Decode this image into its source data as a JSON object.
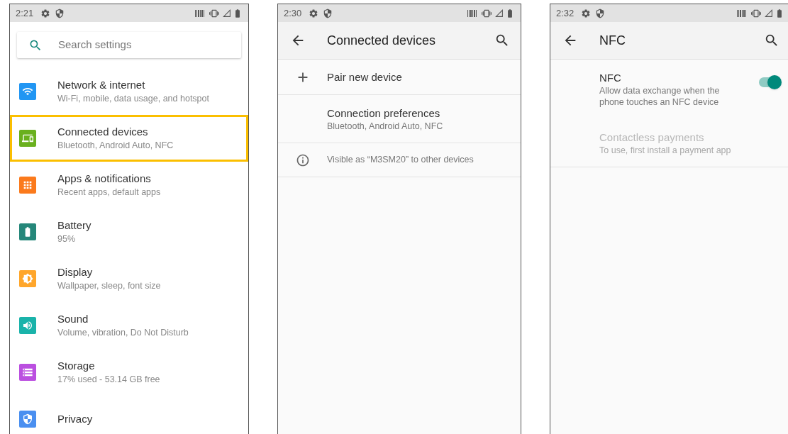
{
  "screens": [
    {
      "kind": "settings_home",
      "time": "2:21",
      "search": {
        "placeholder": "Search settings"
      },
      "items": [
        {
          "title": "Network & internet",
          "subtitle": "Wi-Fi, mobile, data usage, and hotspot",
          "color": "#2196f3",
          "selected": false
        },
        {
          "title": "Connected devices",
          "subtitle": "Bluetooth, Android Auto, NFC",
          "color": "#6ab01e",
          "selected": true
        },
        {
          "title": "Apps & notifications",
          "subtitle": "Recent apps, default apps",
          "color": "#fb7a1c",
          "selected": false
        },
        {
          "title": "Battery",
          "subtitle": "95%",
          "color": "#25877a",
          "selected": false
        },
        {
          "title": "Display",
          "subtitle": "Wallpaper, sleep, font size",
          "color": "#ffa62b",
          "selected": false
        },
        {
          "title": "Sound",
          "subtitle": "Volume, vibration, Do Not Disturb",
          "color": "#1ab3aa",
          "selected": false
        },
        {
          "title": "Storage",
          "subtitle": "17% used - 53.14 GB free",
          "color": "#bb4fe0",
          "selected": false
        },
        {
          "title": "Privacy",
          "color": "#4a8ff0",
          "selected": false
        }
      ]
    },
    {
      "kind": "list",
      "time": "2:30",
      "title": "Connected devices",
      "rows": [
        {
          "kind": "action",
          "title": "Pair new device",
          "disabled": false
        },
        {
          "kind": "item",
          "title": "Connection preferences",
          "subtitle": "Bluetooth, Android Auto, NFC",
          "disabled": false
        },
        {
          "kind": "info",
          "title": "Visible as “M3SM20” to other devices",
          "disabled": false
        }
      ]
    },
    {
      "kind": "list",
      "time": "2:32",
      "title": "NFC",
      "rows": [
        {
          "kind": "switch",
          "title": "NFC",
          "subtitle": "Allow data exchange when the phone touches an NFC device",
          "on": true,
          "disabled": false
        },
        {
          "kind": "item",
          "title": "Contactless payments",
          "subtitle": "To use, first install a payment app",
          "disabled": true
        }
      ]
    }
  ]
}
